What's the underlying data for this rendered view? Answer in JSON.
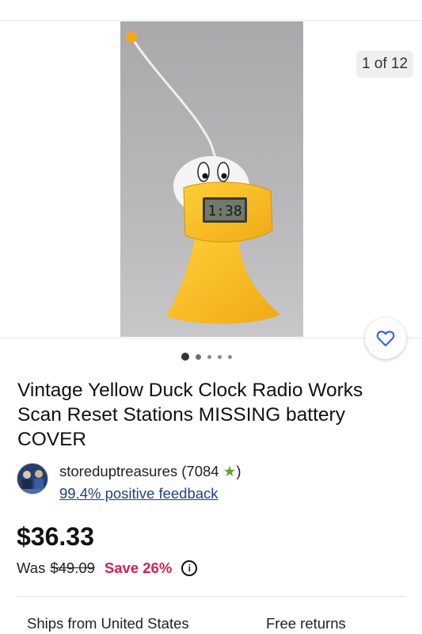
{
  "gallery": {
    "counter": "1 of 12",
    "dots": 5,
    "active_dot": 0,
    "clock_display": "1:38"
  },
  "listing": {
    "title": "Vintage Yellow Duck Clock Radio Works Scan Reset Stations MISSING battery COVER"
  },
  "seller": {
    "name_and_count": "storeduptreasures (7084",
    "star": "★",
    "close_paren": ")",
    "feedback": "99.4% positive feedback"
  },
  "pricing": {
    "price": "$36.33",
    "was_label": "Was",
    "was_price": "$49.09",
    "save": "Save 26%",
    "info_glyph": "i"
  },
  "shipping": {
    "ships_from": "Ships from United States",
    "returns": "Free returns"
  },
  "colors": {
    "save_red": "#d51f4f",
    "link_blue": "#1f3e8f",
    "star_green": "#5aa832",
    "heart_blue": "#3665f3"
  },
  "icons": {
    "watch": "heart-icon",
    "info": "info-icon",
    "star": "star-icon"
  }
}
